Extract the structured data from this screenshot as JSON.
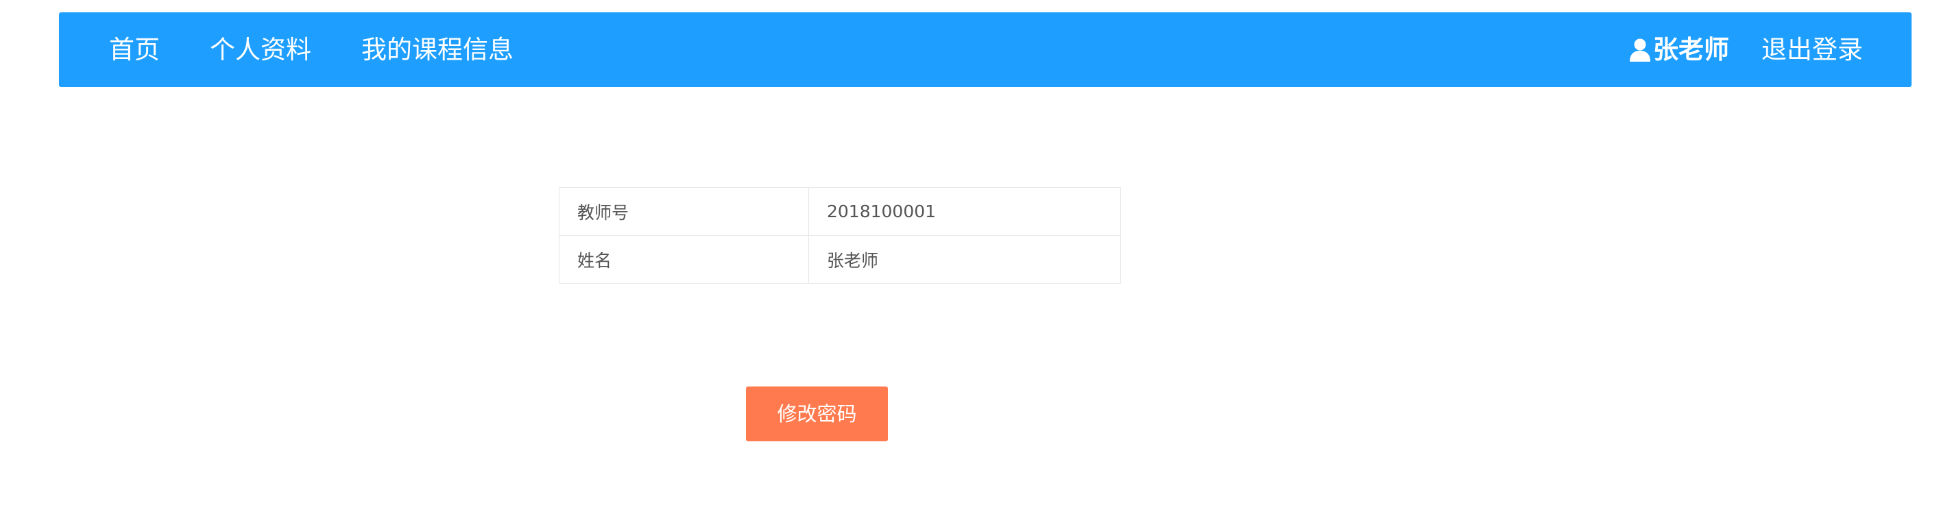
{
  "navbar": {
    "left_links": [
      {
        "label": "首页"
      },
      {
        "label": "个人资料"
      },
      {
        "label": "我的课程信息"
      }
    ],
    "user": {
      "icon": "user-icon",
      "name": "张老师"
    },
    "logout_label": "退出登录",
    "background_color": "#1e9fff"
  },
  "info_table": {
    "rows": [
      {
        "label": "教师号",
        "value": "2018100001"
      },
      {
        "label": "姓名",
        "value": "张老师"
      }
    ]
  },
  "change_password_button": {
    "label": "修改密码",
    "color": "#ff7b4f"
  }
}
